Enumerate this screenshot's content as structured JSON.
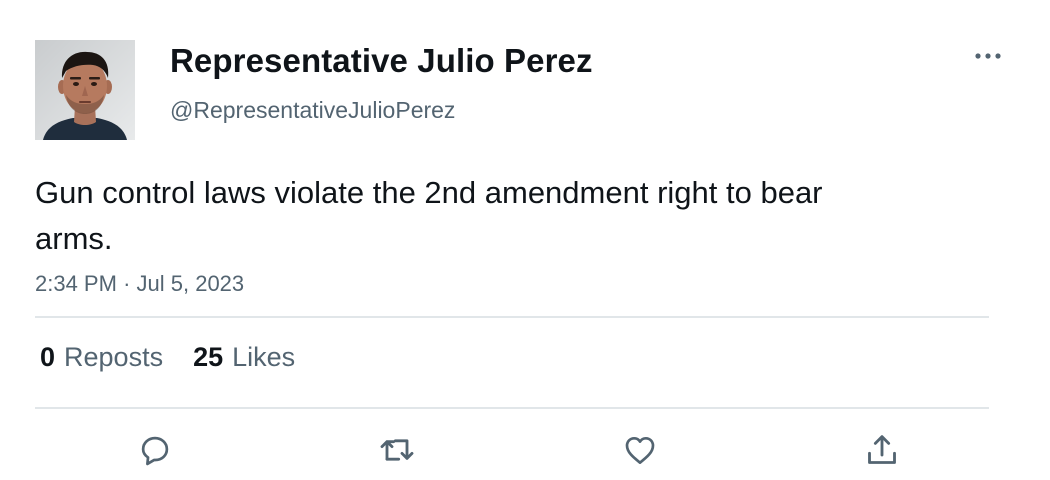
{
  "author": {
    "display_name": "Representative Julio Perez",
    "handle": "@RepresentativeJulioPerez",
    "avatar_icon": "profile-photo"
  },
  "tweet": {
    "text": "Gun control laws violate the 2nd amendment right to bear arms.",
    "time": "2:34 PM",
    "separator": "·",
    "date": "Jul 5, 2023"
  },
  "stats": {
    "reposts_count": "0",
    "reposts_label": "Reposts",
    "likes_count": "25",
    "likes_label": "Likes"
  },
  "actions": [
    {
      "icon": "reply-icon"
    },
    {
      "icon": "repost-icon"
    },
    {
      "icon": "like-icon"
    },
    {
      "icon": "share-icon"
    }
  ],
  "colors": {
    "text_primary": "#0f1419",
    "text_secondary": "#536471",
    "divider": "#e1e6e9",
    "icon": "#536471"
  }
}
